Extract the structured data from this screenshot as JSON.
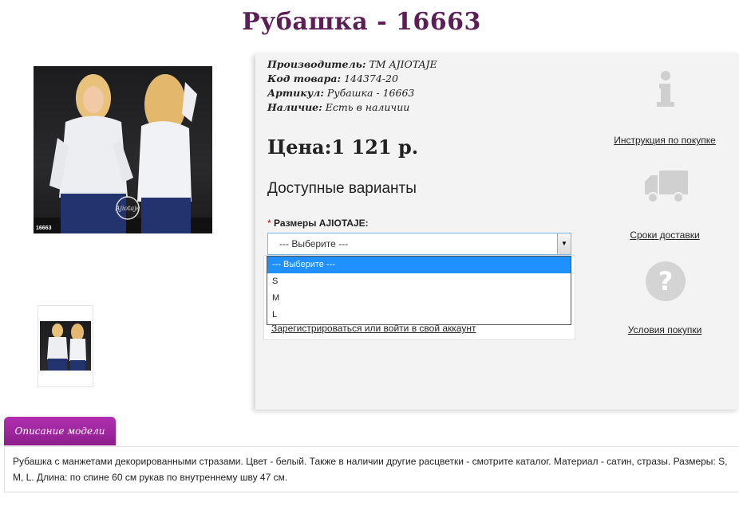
{
  "product": {
    "title": "Рубашка - 16663",
    "photo_sku": "16663",
    "meta": [
      {
        "label": "Производитель:",
        "value": "ТМ AJIOTAJE"
      },
      {
        "label": "Код товара:",
        "value": "144374-20"
      },
      {
        "label": "Артикул:",
        "value": "Рубашка - 16663"
      },
      {
        "label": "Наличие:",
        "value": "Есть в наличии"
      }
    ],
    "price": "Цена:1 121 р.",
    "variants_heading": "Доступные варианты",
    "size_required_mark": "*",
    "size_label": "Размеры AJIOTAJE:",
    "size_select_value": "--- Выберите ---",
    "size_options": [
      "--- Выберите ---",
      "S",
      "M",
      "L"
    ],
    "login_link": "Зарегистрироваться или войти в свой аккаунт"
  },
  "sidebar": {
    "instruction_link": "Инструкция по покупке",
    "delivery_link": "Сроки доставки",
    "terms_link": "Условия покупки"
  },
  "description": {
    "tab_label": "Описание модели",
    "text": "Рубашка с манжетами декорированными стразами. Цвет - белый. Также в наличии другие расцветки - смотрите каталог. Материал - сатин, стразы. Размеры: S, M, L. Длина: по спине 60 см рукав по внутреннему шву 47 см."
  },
  "colors": {
    "title": "#5c1f55",
    "tab": "#9c259c",
    "dropdown_selected": "#1e90ff"
  }
}
